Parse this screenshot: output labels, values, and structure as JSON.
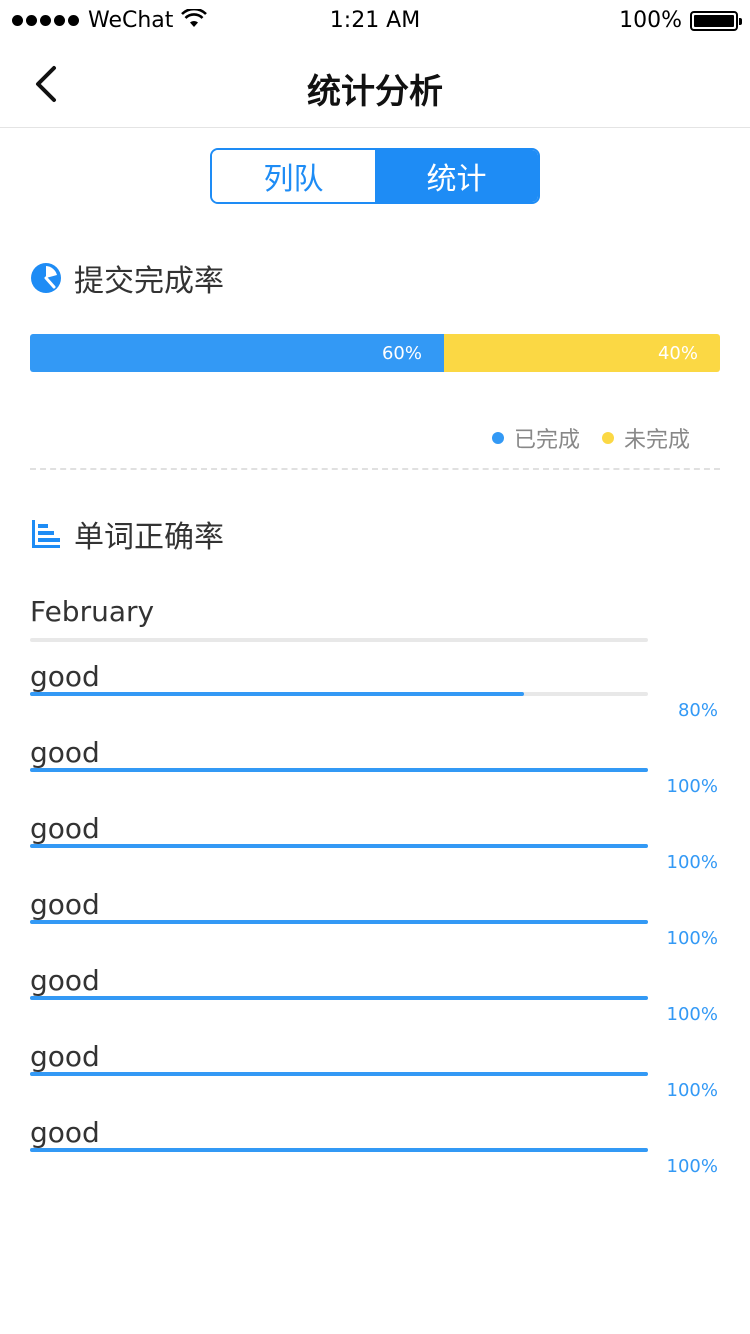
{
  "status_bar": {
    "carrier": "WeChat",
    "time": "1:21 AM",
    "battery": "100%"
  },
  "nav": {
    "title": "统计分析"
  },
  "tabs": [
    {
      "label": "列队",
      "active": false
    },
    {
      "label": "统计",
      "active": true
    }
  ],
  "completion": {
    "title": "提交完成率",
    "done_percent": 60,
    "done_label": "60%",
    "undone_percent": 40,
    "undone_label": "40%",
    "legend_done": "已完成",
    "legend_undone": "未完成",
    "colors": {
      "done": "#3399f5",
      "undone": "#fbd844"
    }
  },
  "accuracy": {
    "title": "单词正确率",
    "month": "February",
    "items": [
      {
        "word": "good",
        "percent": 80,
        "label": "80%"
      },
      {
        "word": "good",
        "percent": 100,
        "label": "100%"
      },
      {
        "word": "good",
        "percent": 100,
        "label": "100%"
      },
      {
        "word": "good",
        "percent": 100,
        "label": "100%"
      },
      {
        "word": "good",
        "percent": 100,
        "label": "100%"
      },
      {
        "word": "good",
        "percent": 100,
        "label": "100%"
      },
      {
        "word": "good",
        "percent": 100,
        "label": "100%"
      }
    ]
  },
  "icons": {
    "back": "chevron-left-icon",
    "completion": "pie-chart-icon",
    "accuracy": "bar-chart-icon",
    "wifi": "wifi-icon",
    "battery": "battery-icon"
  }
}
